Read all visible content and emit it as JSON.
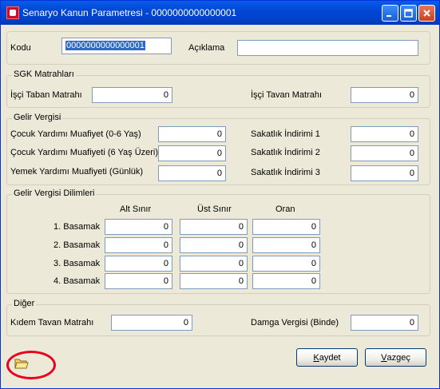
{
  "window": {
    "title": "Senaryo Kanun Parametresi - 0000000000000001",
    "app_icon": "app-icon",
    "controls": [
      "minimize-icon",
      "maximize-icon",
      "close-icon"
    ]
  },
  "header": {
    "kodu_label": "Kodu",
    "kodu_value": "0000000000000001",
    "aciklama_label": "Açıklama",
    "aciklama_value": ""
  },
  "sgk": {
    "title": "SGK Matrahları",
    "taban_label": "İşçi Taban Matrahı",
    "taban_value": "0",
    "tavan_label": "İşçi Tavan Matrahı",
    "tavan_value": "0"
  },
  "gelir_vergisi": {
    "title": "Gelir Vergisi",
    "cocuk_0_6_label": "Çocuk Yardımı Muafiyet (0-6 Yaş)",
    "cocuk_0_6_value": "0",
    "cocuk_6_plus_label": "Çocuk Yardımı Muafiyeti (6 Yaş Üzeri)",
    "cocuk_6_plus_value": "0",
    "yemek_label": "Yemek Yardımı Muafiyeti (Günlük)",
    "yemek_value": "0",
    "sakatlik_1_label": "Sakatlık İndirimi 1",
    "sakatlik_1_value": "0",
    "sakatlik_2_label": "Sakatlık İndirimi 2",
    "sakatlik_2_value": "0",
    "sakatlik_3_label": "Sakatlık İndirimi 3",
    "sakatlik_3_value": "0"
  },
  "dilimler": {
    "title": "Gelir Vergisi Dilimleri",
    "columns": [
      "Alt Sınır",
      "Üst Sınır",
      "Oran"
    ],
    "rows": [
      {
        "label": "1. Basamak",
        "alt": "0",
        "ust": "0",
        "oran": "0"
      },
      {
        "label": "2. Basamak",
        "alt": "0",
        "ust": "0",
        "oran": "0"
      },
      {
        "label": "3. Basamak",
        "alt": "0",
        "ust": "0",
        "oran": "0"
      },
      {
        "label": "4. Basamak",
        "alt": "0",
        "ust": "0",
        "oran": "0"
      }
    ]
  },
  "diger": {
    "title": "Diğer",
    "kidem_label": "Kıdem Tavan Matrahı",
    "kidem_value": "0",
    "damga_label": "Damga Vergisi (Binde)",
    "damga_value": "0"
  },
  "footer": {
    "folder_icon": "folder-icon",
    "save_mnemonic": "K",
    "save_rest": "aydet",
    "cancel_mnemonic": "V",
    "cancel_rest": "azgeç",
    "highlight_color": "#e8001c"
  }
}
